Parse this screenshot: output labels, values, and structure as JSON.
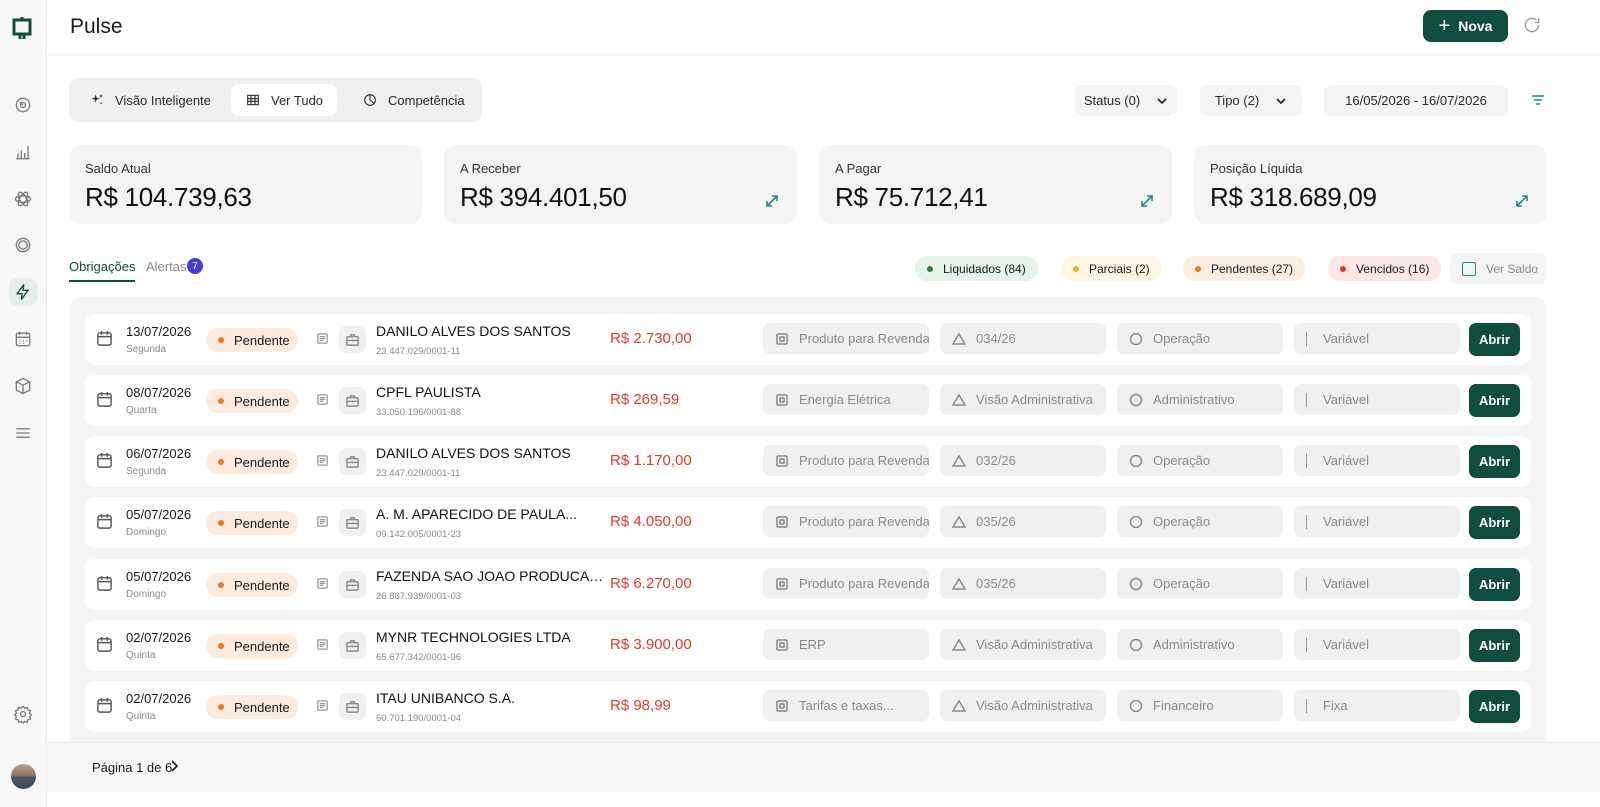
{
  "app": {
    "title": "Pulse",
    "new_button": "Nova"
  },
  "views": [
    {
      "label": "Visão Inteligente",
      "icon": "sparkles-icon"
    },
    {
      "label": "Ver Tudo",
      "icon": "grid-icon",
      "active": true
    },
    {
      "label": "Competência",
      "icon": "pie-chart-icon"
    }
  ],
  "filters": {
    "status": "Status (0)",
    "tipo": "Tipo (2)",
    "date_range": "16/05/2026 - 16/07/2026"
  },
  "cards": [
    {
      "label": "Saldo Atual",
      "value": "R$ 104.739,63"
    },
    {
      "label": "A Receber",
      "value": "R$ 394.401,50"
    },
    {
      "label": "A Pagar",
      "value": "R$ 75.712,41"
    },
    {
      "label": "Posição Líquida",
      "value": "R$ 318.689,09"
    }
  ],
  "tabs": {
    "obrigacoes": "Obrigações",
    "alertas": "Alertas",
    "alertas_count": "7"
  },
  "legend": [
    {
      "label": "Liquidados (84)",
      "color": "#1e8a3a",
      "bg": "#e6f2ea"
    },
    {
      "label": "Parciais (2)",
      "color": "#f2b21a",
      "bg": "#fdf6e2"
    },
    {
      "label": "Pendentes (27)",
      "color": "#f07a1a",
      "bg": "#fdeee4"
    },
    {
      "label": "Vencidos (16)",
      "color": "#e03a2a",
      "bg": "#fde7e5"
    }
  ],
  "ver_saldo": "Ver Saldo",
  "rows": [
    {
      "date": "13/07/2026",
      "weekday": "Segunda",
      "status": "Pendente",
      "name": "DANILO ALVES DOS SANTOS",
      "doc": "23.447.029/0001-11",
      "amount": "R$ 2.730,00",
      "category": "Produto para Revenda",
      "project": "034/26",
      "area": "Operação",
      "type": "Variável",
      "action": "Abrir"
    },
    {
      "date": "08/07/2026",
      "weekday": "Quarta",
      "status": "Pendente",
      "name": "CPFL PAULISTA",
      "doc": "33.050.196/0001-88",
      "amount": "R$ 269,59",
      "category": "Energia Elétrica",
      "project": "Visão Administrativa",
      "area": "Administrativo",
      "type": "Variável",
      "action": "Abrir"
    },
    {
      "date": "06/07/2026",
      "weekday": "Segunda",
      "status": "Pendente",
      "name": "DANILO ALVES DOS SANTOS",
      "doc": "23.447.029/0001-11",
      "amount": "R$ 1.170,00",
      "category": "Produto para Revenda",
      "project": "032/26",
      "area": "Operação",
      "type": "Variável",
      "action": "Abrir"
    },
    {
      "date": "05/07/2026",
      "weekday": "Domingo",
      "status": "Pendente",
      "name": "A. M. APARECIDO DE PAULA...",
      "doc": "09.142.005/0001-23",
      "amount": "R$ 4.050,00",
      "category": "Produto para Revenda",
      "project": "035/26",
      "area": "Operação",
      "type": "Variável",
      "action": "Abrir"
    },
    {
      "date": "05/07/2026",
      "weekday": "Domingo",
      "status": "Pendente",
      "name": "FAZENDA SAO JOAO PRODUCAO...",
      "doc": "26.887.939/0001-03",
      "amount": "R$ 6.270,00",
      "category": "Produto para Revenda",
      "project": "035/26",
      "area": "Operação",
      "type": "Variável",
      "action": "Abrir"
    },
    {
      "date": "02/07/2026",
      "weekday": "Quinta",
      "status": "Pendente",
      "name": "MYNR TECHNOLOGIES LTDA",
      "doc": "65.677.342/0001-96",
      "amount": "R$ 3.900,00",
      "category": "ERP",
      "project": "Visão Administrativa",
      "area": "Administrativo",
      "type": "Variável",
      "action": "Abrir"
    },
    {
      "date": "02/07/2026",
      "weekday": "Quinta",
      "status": "Pendente",
      "name": "ITAU UNIBANCO S.A.",
      "doc": "60.701.190/0001-04",
      "amount": "R$ 98,99",
      "category": "Tarifas e taxas...",
      "project": "Visão Administrativa",
      "area": "Financeiro",
      "type": "Fixa",
      "action": "Abrir"
    }
  ],
  "pagination": {
    "label": "Página 1 de 6"
  },
  "colors": {
    "brand": "#0f4d3e",
    "accent": "#1e8a8a",
    "negative": "#e03a2a"
  }
}
